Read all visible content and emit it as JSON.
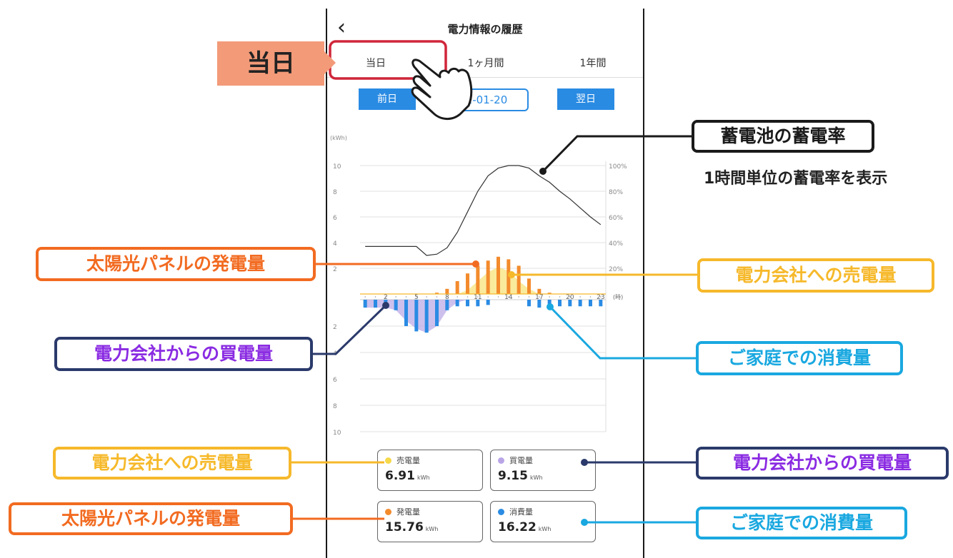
{
  "header": {
    "title": "電力情報の履歴",
    "back_icon": "chevron-left-icon"
  },
  "tabs": [
    {
      "label": "当日",
      "selected": true
    },
    {
      "label": "1ヶ月間",
      "selected": false
    },
    {
      "label": "1年間",
      "selected": false
    }
  ],
  "date_nav": {
    "prev_label": "前日",
    "date": "2-01-20",
    "next_label": "翌日"
  },
  "chart_data": {
    "type": "bar",
    "left_unit": "(kWh)",
    "right_unit": "",
    "x_unit": "(時)",
    "x_ticks": [
      "2",
      "5",
      "8",
      "11",
      "14",
      "17",
      "20",
      "23"
    ],
    "y_upper_ticks": [
      "10",
      "8",
      "6",
      "4",
      "2"
    ],
    "y_lower_ticks": [
      "2",
      "4",
      "6",
      "8",
      "10"
    ],
    "y_right_ticks": [
      "100%",
      "80%",
      "60%",
      "40%",
      "20%"
    ],
    "hours": [
      0,
      1,
      2,
      3,
      4,
      5,
      6,
      7,
      8,
      9,
      10,
      11,
      12,
      13,
      14,
      15,
      16,
      17,
      18,
      19,
      20,
      21,
      22,
      23
    ],
    "generation": [
      0,
      0,
      0,
      0,
      0,
      0,
      0,
      0.1,
      0.4,
      1.0,
      1.6,
      2.2,
      2.6,
      2.9,
      2.7,
      2.2,
      1.2,
      0.4,
      0.1,
      0,
      0,
      0,
      0,
      0
    ],
    "sell": [
      0,
      0,
      0,
      0,
      0,
      0,
      0,
      0,
      0,
      0,
      0.3,
      1.0,
      1.7,
      2.1,
      1.8,
      1.0,
      0.4,
      0,
      0,
      0,
      0,
      0,
      0,
      0
    ],
    "buy": [
      0.6,
      0.6,
      0.6,
      0.8,
      1.6,
      2.2,
      2.5,
      2.0,
      0.8,
      0.2,
      0,
      0,
      0,
      0,
      0,
      0,
      0,
      0,
      0,
      0,
      0,
      0,
      0,
      0
    ],
    "consumption": [
      0.6,
      0.6,
      0.6,
      0.8,
      2.0,
      2.4,
      2.5,
      2.0,
      0.8,
      0.5,
      0.5,
      0.5,
      0.4,
      0,
      0,
      0,
      0.5,
      0.6,
      0.6,
      0.5,
      0.5,
      0.5,
      0.5,
      0.5
    ],
    "battery_pct": [
      37,
      37,
      37,
      37,
      37,
      37,
      30,
      31,
      36,
      48,
      64,
      80,
      92,
      98,
      100,
      100,
      98,
      92,
      87,
      80,
      74,
      67,
      60,
      54
    ],
    "colors": {
      "generation": "#f38b2c",
      "sell": "#f6d94a",
      "buy": "#b9a5e6",
      "consumption": "#2a8be3",
      "battery": "#333333"
    }
  },
  "summary": [
    {
      "label": "売電量",
      "value": "6.91",
      "unit": "kWh",
      "color": "#f6d94a"
    },
    {
      "label": "買電量",
      "value": "9.15",
      "unit": "kWh",
      "color": "#b9a5e6"
    },
    {
      "label": "発電量",
      "value": "15.76",
      "unit": "kWh",
      "color": "#f38b2c"
    },
    {
      "label": "消費量",
      "value": "16.22",
      "unit": "kWh",
      "color": "#2a8be3"
    }
  ],
  "annotations": {
    "tab_label": "当日",
    "battery": "蓄電池の蓄電率",
    "battery_note": "1時間単位の蓄電率を表示",
    "solar": "太陽光パネルの発電量",
    "sell": "電力会社への売電量",
    "buy": "電力会社からの買電量",
    "consumption": "ご家庭での消費量",
    "colors": {
      "tab": "#f39a78",
      "tab_border": "#d0263a",
      "solar": "#f26b21",
      "sell": "#f6b92b",
      "buy": "#2b3a6b",
      "buy_text": "#8a2be2",
      "consumption": "#1aa8e0",
      "battery": "#1a1a1a"
    }
  }
}
